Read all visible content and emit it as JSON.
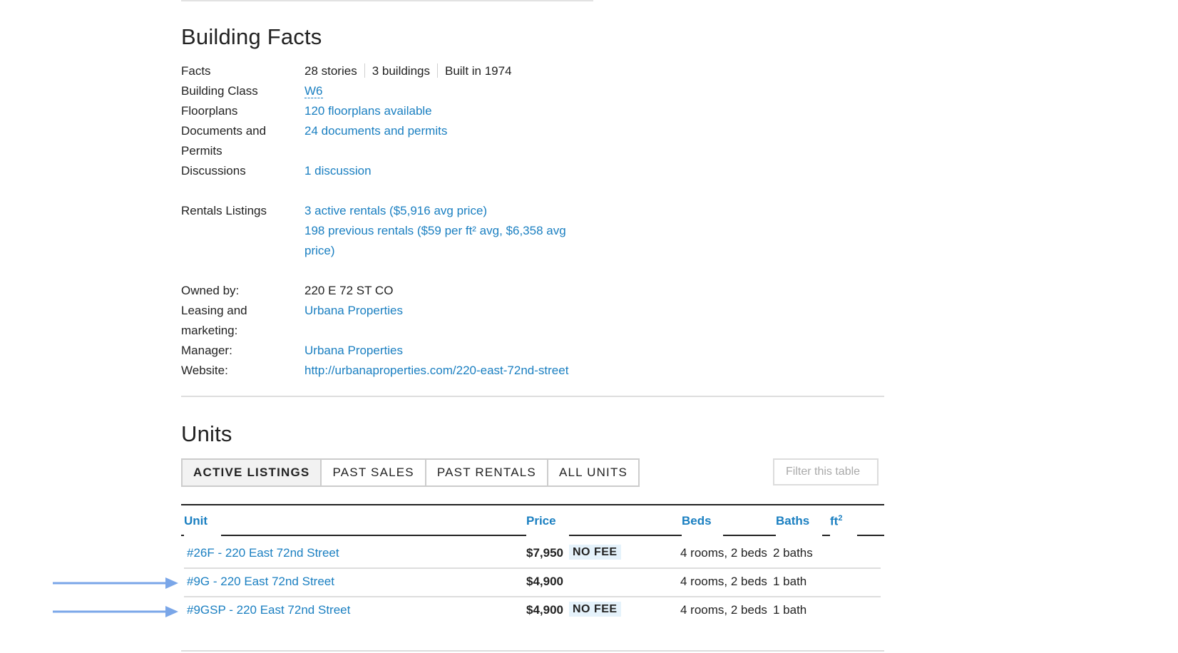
{
  "building_facts": {
    "title": "Building Facts",
    "facts_label": "Facts",
    "facts": [
      "28 stories",
      "3 buildings",
      "Built in 1974"
    ],
    "building_class_label": "Building Class",
    "building_class": "W6",
    "floorplans_label": "Floorplans",
    "floorplans": "120 floorplans available",
    "documents_label_1": "Documents and",
    "documents_label_2": "Permits",
    "documents": "24 documents and permits",
    "discussions_label": "Discussions",
    "discussions": "1 discussion",
    "rentals_label": "Rentals Listings",
    "rentals_active": "3 active rentals ($5,916 avg price)",
    "rentals_previous_1": "198 previous rentals ($59 per ft² avg, $6,358 avg",
    "rentals_previous_2": "price)",
    "owned_label": "Owned by:",
    "owned": "220 E 72 ST CO",
    "leasing_label_1": "Leasing and",
    "leasing_label_2": "marketing:",
    "leasing": "Urbana Properties",
    "manager_label": "Manager:",
    "manager": "Urbana Properties",
    "website_label": "Website:",
    "website": "http://urbanaproperties.com/220-east-72nd-street"
  },
  "units": {
    "title": "Units",
    "tabs": [
      {
        "label": "ACTIVE LISTINGS",
        "active": true
      },
      {
        "label": "PAST SALES",
        "active": false
      },
      {
        "label": "PAST RENTALS",
        "active": false
      },
      {
        "label": "ALL UNITS",
        "active": false
      }
    ],
    "filter_placeholder": "Filter this table",
    "columns": {
      "unit": "Unit",
      "price": "Price",
      "beds": "Beds",
      "baths": "Baths",
      "sqft": "ft",
      "sqft_sup": "2"
    },
    "rows": [
      {
        "unit": "#26F - 220 East 72nd Street",
        "price": "$7,950",
        "badge": "NO FEE",
        "beds": "4 rooms, 2 beds",
        "baths": "2 baths",
        "arrow": false
      },
      {
        "unit": "#9G - 220 East 72nd Street",
        "price": "$4,900",
        "badge": "",
        "beds": "4 rooms, 2 beds",
        "baths": "1 bath",
        "arrow": true
      },
      {
        "unit": "#9GSP - 220 East 72nd Street",
        "price": "$4,900",
        "badge": "NO FEE",
        "beds": "4 rooms, 2 beds",
        "baths": "1 bath",
        "arrow": true
      }
    ]
  },
  "colors": {
    "link": "#1a7fc1",
    "badge_bg": "#e5f2fb",
    "arrow": "#7aa6e8"
  }
}
